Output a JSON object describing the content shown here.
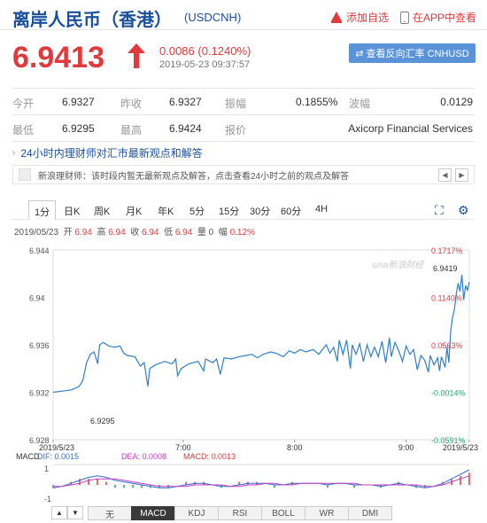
{
  "header": {
    "title": "离岸人民币（香港）",
    "code": "(USDCNH)",
    "add_watch": "添加自选",
    "open_app": "在APP中查看"
  },
  "quote": {
    "price": "6.9413",
    "change": "0.0086 (0.1240%)",
    "timestamp": "2019-05-23 09:37:57",
    "reverse_button": "查看反向汇率 CNHUSD"
  },
  "stats": {
    "open_label": "今开",
    "open": "6.9327",
    "prev_label": "昨收",
    "prev": "6.9327",
    "amp_label": "振幅",
    "amp": "0.1855%",
    "wave_label": "波幅",
    "wave": "0.0129",
    "low_label": "最低",
    "low": "6.9295",
    "high_label": "最高",
    "high": "6.9424",
    "quoter_label": "报价",
    "quoter": "Axicorp Financial Services"
  },
  "news": {
    "heading": "24小时内理财师对汇市最新观点和解答",
    "item": "新浪理财师：该时段内暂无最新观点及解答，点击查看24小时之前的观点及解答"
  },
  "tabs": [
    "1分",
    "日K",
    "周K",
    "月K",
    "年K",
    "5分",
    "15分",
    "30分",
    "60分",
    "4H"
  ],
  "ohlc": {
    "date": "2019/05/23",
    "open_label": "开",
    "open": "6.94",
    "high_label": "高",
    "high": "6.94",
    "close_label": "收",
    "close": "6.94",
    "low_label": "低",
    "low": "6.94",
    "vol_label": "量",
    "vol": "0",
    "amp_label": "幅",
    "amp": "0.12%"
  },
  "chart_data": {
    "type": "line",
    "watermark": "sina新浪财经",
    "y_ticks": [
      "6.944",
      "6.94",
      "6.936",
      "6.932",
      "6.928"
    ],
    "pct_ticks": [
      "0.1717%",
      "0.1140%",
      "0.0563%",
      "-0.0014%",
      "-0.0591%"
    ],
    "x_ticks": [
      "2019/5/23",
      "7:00",
      "8:00",
      "9:00",
      "2019/5/23"
    ],
    "ylim": [
      6.928,
      6.944
    ],
    "high_label": "6.9419",
    "low_label": "6.9295",
    "series_color": "#2f7fc8",
    "series": [
      {
        "t": 0,
        "v": 6.932
      },
      {
        "t": 5,
        "v": 6.9321
      },
      {
        "t": 10,
        "v": 6.9322
      },
      {
        "t": 14,
        "v": 6.9325
      },
      {
        "t": 16,
        "v": 6.933
      },
      {
        "t": 18,
        "v": 6.9345
      },
      {
        "t": 20,
        "v": 6.9352
      },
      {
        "t": 22,
        "v": 6.9354
      },
      {
        "t": 24,
        "v": 6.9344
      },
      {
        "t": 25,
        "v": 6.936
      },
      {
        "t": 27,
        "v": 6.9362
      },
      {
        "t": 30,
        "v": 6.9359
      },
      {
        "t": 33,
        "v": 6.9358
      },
      {
        "t": 36,
        "v": 6.9359
      },
      {
        "t": 38,
        "v": 6.9353
      },
      {
        "t": 40,
        "v": 6.9351
      },
      {
        "t": 44,
        "v": 6.935
      },
      {
        "t": 47,
        "v": 6.9342
      },
      {
        "t": 49,
        "v": 6.9345
      },
      {
        "t": 51,
        "v": 6.9325
      },
      {
        "t": 52,
        "v": 6.934
      },
      {
        "t": 55,
        "v": 6.9343
      },
      {
        "t": 60,
        "v": 6.9346
      },
      {
        "t": 64,
        "v": 6.9344
      },
      {
        "t": 66,
        "v": 6.9348
      },
      {
        "t": 67,
        "v": 6.9334
      },
      {
        "t": 69,
        "v": 6.934
      },
      {
        "t": 73,
        "v": 6.9344
      },
      {
        "t": 78,
        "v": 6.9346
      },
      {
        "t": 81,
        "v": 6.9338
      },
      {
        "t": 82,
        "v": 6.9348
      },
      {
        "t": 86,
        "v": 6.9345
      },
      {
        "t": 88,
        "v": 6.9348
      },
      {
        "t": 90,
        "v": 6.9335
      },
      {
        "t": 92,
        "v": 6.9349
      },
      {
        "t": 96,
        "v": 6.9348
      },
      {
        "t": 100,
        "v": 6.935
      },
      {
        "t": 104,
        "v": 6.9351
      },
      {
        "t": 107,
        "v": 6.9352
      },
      {
        "t": 110,
        "v": 6.9349
      },
      {
        "t": 113,
        "v": 6.9352
      },
      {
        "t": 117,
        "v": 6.9354
      },
      {
        "t": 120,
        "v": 6.9353
      },
      {
        "t": 124,
        "v": 6.935
      },
      {
        "t": 127,
        "v": 6.9355
      },
      {
        "t": 130,
        "v": 6.9353
      },
      {
        "t": 133,
        "v": 6.9356
      },
      {
        "t": 136,
        "v": 6.9354
      },
      {
        "t": 140,
        "v": 6.9356
      },
      {
        "t": 143,
        "v": 6.9352
      },
      {
        "t": 145,
        "v": 6.9356
      },
      {
        "t": 147,
        "v": 6.936
      },
      {
        "t": 149,
        "v": 6.9353
      },
      {
        "t": 151,
        "v": 6.9358
      },
      {
        "t": 153,
        "v": 6.9346
      },
      {
        "t": 154,
        "v": 6.9364
      },
      {
        "t": 156,
        "v": 6.9352
      },
      {
        "t": 158,
        "v": 6.9364
      },
      {
        "t": 160,
        "v": 6.934
      },
      {
        "t": 161,
        "v": 6.936
      },
      {
        "t": 163,
        "v": 6.9352
      },
      {
        "t": 165,
        "v": 6.9361
      },
      {
        "t": 167,
        "v": 6.9346
      },
      {
        "t": 169,
        "v": 6.936
      },
      {
        "t": 171,
        "v": 6.935
      },
      {
        "t": 173,
        "v": 6.9358
      },
      {
        "t": 175,
        "v": 6.935
      },
      {
        "t": 177,
        "v": 6.9363
      },
      {
        "t": 179,
        "v": 6.9345
      },
      {
        "t": 181,
        "v": 6.9366
      },
      {
        "t": 182,
        "v": 6.935
      },
      {
        "t": 184,
        "v": 6.9362
      },
      {
        "t": 186,
        "v": 6.9355
      },
      {
        "t": 188,
        "v": 6.9346
      },
      {
        "t": 190,
        "v": 6.9359
      },
      {
        "t": 192,
        "v": 6.9352
      },
      {
        "t": 194,
        "v": 6.9356
      },
      {
        "t": 196,
        "v": 6.9339
      },
      {
        "t": 198,
        "v": 6.9351
      },
      {
        "t": 200,
        "v": 6.9347
      },
      {
        "t": 202,
        "v": 6.9337
      },
      {
        "t": 203,
        "v": 6.9351
      },
      {
        "t": 205,
        "v": 6.9343
      },
      {
        "t": 207,
        "v": 6.9349
      },
      {
        "t": 208,
        "v": 6.9338
      },
      {
        "t": 209,
        "v": 6.935
      },
      {
        "t": 211,
        "v": 6.9341
      },
      {
        "t": 212,
        "v": 6.9358
      },
      {
        "t": 213,
        "v": 6.9345
      },
      {
        "t": 214,
        "v": 6.9372
      },
      {
        "t": 215,
        "v": 6.9383
      },
      {
        "t": 216,
        "v": 6.939
      },
      {
        "t": 217,
        "v": 6.9403
      },
      {
        "t": 218,
        "v": 6.9412
      },
      {
        "t": 219,
        "v": 6.9405
      },
      {
        "t": 220,
        "v": 6.9419
      },
      {
        "t": 221,
        "v": 6.9398
      },
      {
        "t": 222,
        "v": 6.941
      },
      {
        "t": 223,
        "v": 6.9406
      },
      {
        "t": 224,
        "v": 6.9413
      }
    ],
    "macd": {
      "dif_label": "DIF: 0.0015",
      "dea_label": "DEA: 0.0008",
      "macd_label": "MACD: 0.0013",
      "y_ticks": [
        "1",
        "-1"
      ],
      "dif_color": "#2f6fd0",
      "dea_color": "#c040c0",
      "up_color": "#e4393c",
      "down_color": "#2aa36b",
      "dif": [
        -0.2,
        -0.1,
        0.1,
        0.3,
        0.5,
        0.6,
        0.5,
        0.3,
        0.2,
        0.1,
        0.0,
        -0.1,
        -0.2,
        -0.2,
        -0.1,
        0.0,
        0.1,
        0.1,
        0.0,
        -0.1,
        -0.1,
        0.0,
        0.1,
        0.1,
        0.1,
        0.0,
        0.0,
        0.1,
        0.1,
        0.1,
        0.1,
        0.0,
        0.1,
        0.1,
        0.0,
        0.0,
        0.0,
        -0.1,
        0.0,
        0.1,
        0.0,
        -0.1,
        -0.2,
        -0.1,
        0.1,
        0.4,
        0.7,
        1.0
      ],
      "dea": [
        -0.1,
        -0.1,
        0.0,
        0.1,
        0.3,
        0.4,
        0.4,
        0.4,
        0.3,
        0.2,
        0.1,
        0.0,
        -0.1,
        -0.1,
        -0.1,
        -0.1,
        0.0,
        0.0,
        0.0,
        0.0,
        -0.1,
        -0.1,
        0.0,
        0.0,
        0.1,
        0.1,
        0.0,
        0.0,
        0.1,
        0.1,
        0.1,
        0.1,
        0.1,
        0.1,
        0.1,
        0.0,
        0.0,
        0.0,
        0.0,
        0.0,
        0.0,
        0.0,
        -0.1,
        -0.1,
        0.0,
        0.2,
        0.4,
        0.6
      ]
    }
  },
  "indicators": [
    "无",
    "MACD",
    "KDJ",
    "RSI",
    "BOLL",
    "WR",
    "DMI"
  ],
  "active_indicator": "MACD"
}
